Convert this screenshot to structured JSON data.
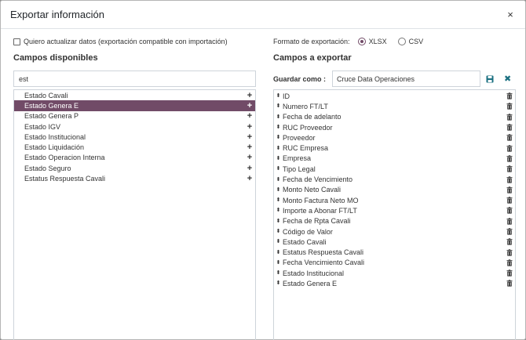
{
  "dialog": {
    "title": "Exportar información",
    "close_glyph": "×"
  },
  "left": {
    "compat_checkbox_label": "Quiero actualizar datos (exportación compatible con importación)",
    "compat_checked": false,
    "available_title": "Campos disponibles",
    "search_value": "est",
    "available_fields": [
      {
        "label": "Estado Cavali",
        "selected": false
      },
      {
        "label": "Estado Genera E",
        "selected": true
      },
      {
        "label": "Estado Genera P",
        "selected": false
      },
      {
        "label": "Estado IGV",
        "selected": false
      },
      {
        "label": "Estado Institucional",
        "selected": false
      },
      {
        "label": "Estado Liquidación",
        "selected": false
      },
      {
        "label": "Estado Operacion Interna",
        "selected": false
      },
      {
        "label": "Estado Seguro",
        "selected": false
      },
      {
        "label": "Estatus Respuesta Cavali",
        "selected": false
      }
    ],
    "add_icon": "plus-icon"
  },
  "right": {
    "format_label": "Formato de exportación:",
    "format_options": [
      {
        "label": "XLSX",
        "checked": true
      },
      {
        "label": "CSV",
        "checked": false
      }
    ],
    "export_title": "Campos a exportar",
    "save_as_label": "Guardar como :",
    "save_as_value": "Cruce Data Operaciones",
    "export_fields": [
      "ID",
      "Numero FT/LT",
      "Fecha de adelanto",
      "RUC Proveedor",
      "Proveedor",
      "RUC Empresa",
      "Empresa",
      "Tipo Legal",
      "Fecha de Vencimiento",
      "Monto Neto Cavali",
      "Monto Factura Neto MO",
      "Importe a Abonar FT/LT",
      "Fecha de Rpta Cavali",
      "Código de Valor",
      "Estado Cavali",
      "Estatus Respuesta Cavali",
      "Fecha Vencimiento Cavali",
      "Estado Institucional",
      "Estado Genera E"
    ]
  },
  "colors": {
    "accent": "#714b67",
    "teal": "#1a6f80"
  }
}
